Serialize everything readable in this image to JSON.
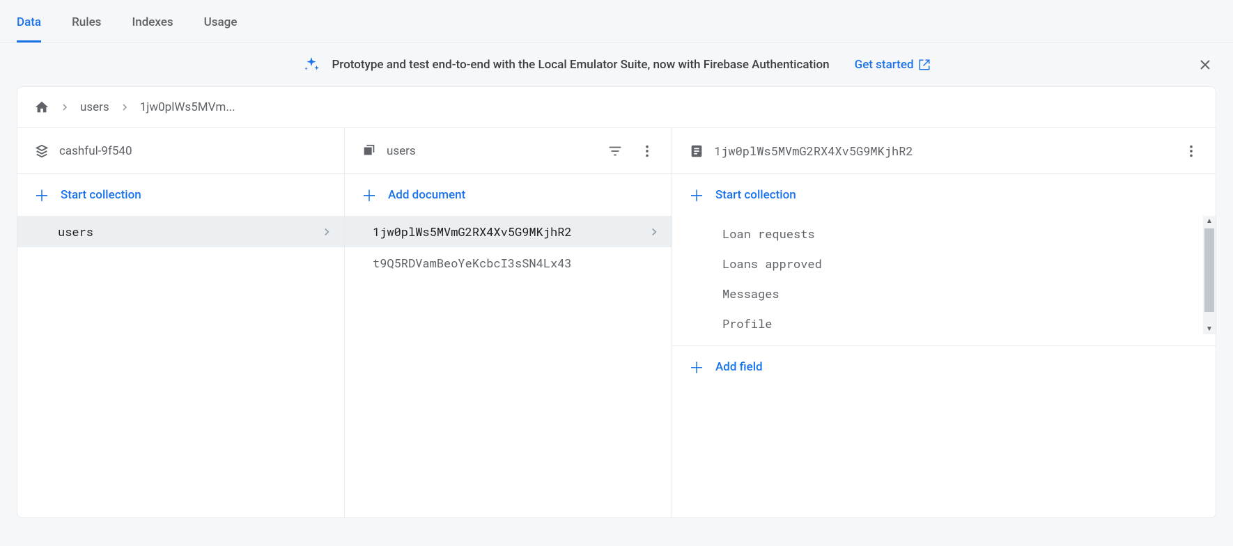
{
  "tabs": [
    "Data",
    "Rules",
    "Indexes",
    "Usage"
  ],
  "active_tab": 0,
  "banner": {
    "text": "Prototype and test end-to-end with the Local Emulator Suite, now with Firebase Authentication",
    "cta": "Get started"
  },
  "breadcrumb": {
    "collection": "users",
    "doc_truncated": "1jw0plWs5MVm..."
  },
  "project": {
    "id": "cashful-9f540"
  },
  "collections_col": {
    "action": "Start collection",
    "items": [
      "users"
    ],
    "selected": 0
  },
  "documents_col": {
    "title": "users",
    "action": "Add document",
    "items": [
      "1jw0plWs5MVmG2RX4Xv5G9MKjhR2",
      "t9Q5RDVamBeoYeKcbcI3sSN4Lx43"
    ],
    "selected": 0
  },
  "doc_col": {
    "doc_id": "1jw0plWs5MVmG2RX4Xv5G9MKjhR2",
    "start_collection": "Start collection",
    "subcollections": [
      "Loan requests",
      "Loans approved",
      "Messages",
      "Profile"
    ],
    "add_field": "Add field"
  }
}
